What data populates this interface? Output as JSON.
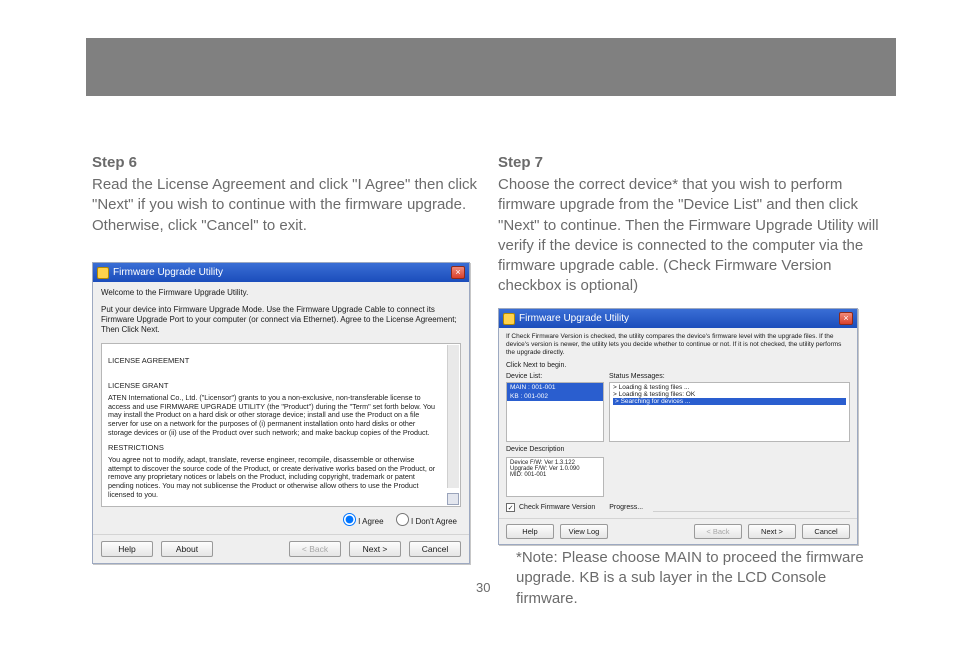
{
  "topbar": {},
  "left": {
    "heading": "Step 6",
    "para": "Read the License Agreement and click \"I Agree\" then click \"Next\" if you wish to continue with the firmware upgrade. Otherwise, click \"Cancel\" to exit."
  },
  "right": {
    "heading": "Step 7",
    "para": "Choose the correct device* that you wish to perform firmware upgrade from the \"Device List\" and then click \"Next\" to continue. Then the Firmware Upgrade Utility will verify if the device is connected to the computer via the firmware upgrade cable. (Check Firmware Version checkbox is optional)",
    "note": "*Note: Please choose MAIN to proceed the firmware upgrade. KB is a sub layer in the LCD Console firmware."
  },
  "dlg1": {
    "title": "Firmware Upgrade Utility",
    "welcome": "Welcome to the Firmware Upgrade Utility.",
    "instr": "Put your device into Firmware Upgrade Mode. Use the Firmware Upgrade Cable to connect its Firmware Upgrade Port to your computer (or connect via Ethernet). Agree to the License Agreement; Then Click Next.",
    "h1": "LICENSE AGREEMENT",
    "h2": "LICENSE GRANT",
    "grant": "ATEN International Co., Ltd. (\"Licensor\") grants to you a non-exclusive, non-transferable license to access and use FIRMWARE UPGRADE UTILITY (the \"Product\") during the \"Term\" set forth below. You may install the Product on a hard disk or other storage device; install and use the Product on a file server for use on a network for the purposes of (i) permanent installation onto hard disks or other storage devices or (ii) use of the Product over such network; and make backup copies of the Product.",
    "h3": "RESTRICTIONS",
    "restr": "You agree not to modify, adapt, translate, reverse engineer, recompile, disassemble or otherwise attempt to discover the source code of the Product, or create derivative works based on the Product, or remove any proprietary notices or labels on the Product, including copyright, trademark or patent pending notices. You may not sublicense the Product or otherwise allow others to use the Product licensed to you.",
    "agree": "I Agree",
    "dontagree": "I Don't Agree",
    "help": "Help",
    "about": "About",
    "back": "< Back",
    "next": "Next >",
    "cancel": "Cancel"
  },
  "dlg2": {
    "title": "Firmware Upgrade Utility",
    "top": "If Check Firmware Version is checked, the utility compares the device's firmware level with the upgrade files. If the device's version is newer, the utility lets you decide whether to continue or not. If it is not checked, the utility performs the upgrade directly.",
    "click": "Click Next to begin.",
    "devlabel": "Device List:",
    "statuslabel": "Status Messages:",
    "dev1": "MAIN : 001-001",
    "dev2": "KB : 001-002",
    "status1": "> Loading & testing files ...",
    "status2": "> Loading & testing files: OK",
    "status3": "> Searching for devices ...",
    "desclabel": "Device Description",
    "desc1": "Device F/W: Ver 1.3.122",
    "desc2": "Upgrade F/W: Ver 1.0.090",
    "desc3": "MID: 001-001",
    "chk": "Check Firmware Version",
    "progress": "Progress...",
    "help": "Help",
    "viewlog": "View Log",
    "back": "< Back",
    "next": "Next >",
    "cancel": "Cancel"
  },
  "page": "30"
}
